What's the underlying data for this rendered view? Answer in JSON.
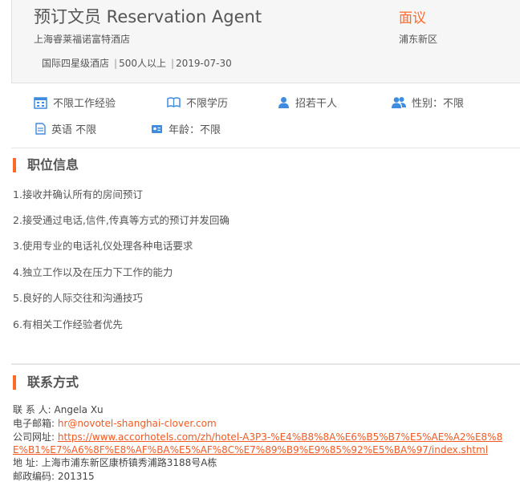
{
  "job": {
    "title": "预订文员 Reservation Agent",
    "salary": "面议",
    "company": "上海睿莱福诺富特酒店",
    "area": "浦东新区",
    "tags": [
      "国际四星级酒店",
      "500人以上",
      "2019-07-30"
    ],
    "tag_sep": "|"
  },
  "requirements": {
    "experience": "不限工作经验",
    "education": "不限学历",
    "headcount": "招若干人",
    "gender": "性别：不限",
    "language": "英语 不限",
    "age": "年龄：不限"
  },
  "colors": {
    "accent": "#ff6a29",
    "link": "#f15a24",
    "icon": "#3d8ce0"
  },
  "position_section": {
    "title": "职位信息",
    "items": [
      "1.接收并确认所有的房间预订",
      "2.接受通过电话,信件,传真等方式的预订并发回确",
      "3.使用专业的电话礼仪处理各种电话要求",
      "4.独立工作以及在压力下工作的能力",
      "5.良好的人际交往和沟通技巧",
      "6.有相关工作经验者优先"
    ]
  },
  "contact_section": {
    "title": "联系方式",
    "person_label": "联 系 人:",
    "person": "Angela Xu",
    "email_label": "电子邮箱:",
    "email": "hr@novotel-shanghai-clover.com",
    "website_label": "公司网址:",
    "website": "https://www.accorhotels.com/zh/hotel-A3P3-%E4%B8%8A%E6%B5%B7%E5%AE%A2%E8%8E%B1%E7%A6%8F%E8%AF%BA%E5%AF%8C%E7%89%B9%E9%85%92%E5%BA%97/index.shtml",
    "address_label": "地 址:",
    "address": "上海市浦东新区康桥镇秀浦路3188号A栋",
    "postcode_label": "邮政编码:",
    "postcode": "201315"
  }
}
